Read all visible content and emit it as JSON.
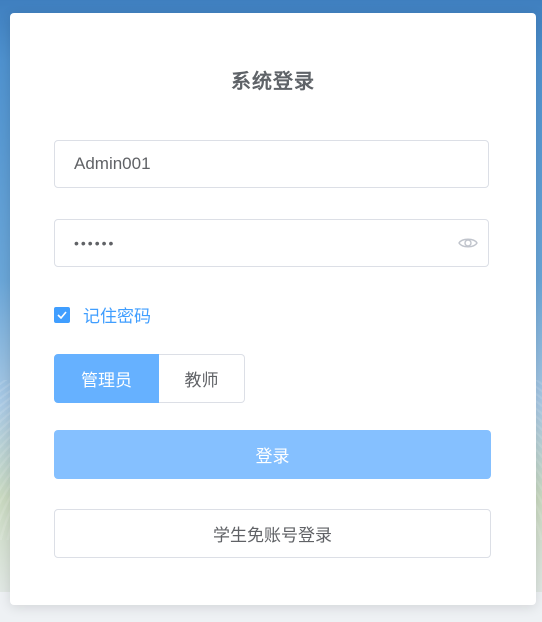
{
  "form": {
    "title": "系统登录",
    "username": {
      "value": "Admin001",
      "placeholder": ""
    },
    "password": {
      "value": "••••••",
      "placeholder": ""
    },
    "remember": {
      "label": "记住密码",
      "checked": true
    },
    "roles": {
      "items": [
        {
          "label": "管理员",
          "selected": true
        },
        {
          "label": "教师",
          "selected": false
        }
      ]
    },
    "login_button": "登录",
    "student_button": "学生免账号登录"
  },
  "colors": {
    "primary": "#409eff",
    "selected_role": "#66b1ff",
    "login_button": "#85c0ff"
  },
  "icons": {
    "password_toggle": "eye-icon",
    "remember_check": "checkmark-icon"
  }
}
